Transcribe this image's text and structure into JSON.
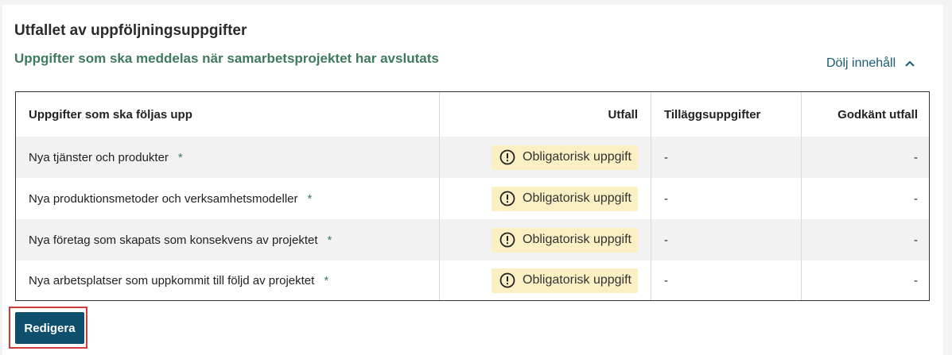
{
  "section": {
    "title": "Utfallet av uppföljningsuppgifter",
    "subtitle": "Uppgifter som ska meddelas när samarbetsprojektet har avslutats",
    "toggle_label": "Dölj innehåll",
    "toggle_icon": "chevron-up-icon"
  },
  "table": {
    "headers": [
      "Uppgifter som ska följas upp",
      "Utfall",
      "Tilläggsuppgifter",
      "Godkänt utfall"
    ],
    "rows": [
      {
        "task": "Nya tjänster och produkter",
        "required_mark": "*",
        "outcome": "Obligatorisk uppgift",
        "additional": "-",
        "approved": "-"
      },
      {
        "task": "Nya produktionsmetoder och verksamhetsmodeller",
        "required_mark": "*",
        "outcome": "Obligatorisk uppgift",
        "additional": "-",
        "approved": "-"
      },
      {
        "task": "Nya företag som skapats som konsekvens av projektet",
        "required_mark": "*",
        "outcome": "Obligatorisk uppgift",
        "additional": "-",
        "approved": "-"
      },
      {
        "task": "Nya arbetsplatser som uppkommit till följd av projektet",
        "required_mark": "*",
        "outcome": "Obligatorisk uppgift",
        "additional": "-",
        "approved": "-"
      }
    ],
    "badge_icon": "alert-circle-icon",
    "badge_color": "#fbefc4"
  },
  "actions": {
    "edit_label": "Redigera",
    "edit_color": "#0e4f6e",
    "highlight_color": "#d23a3a"
  },
  "colors": {
    "accent_green": "#3e7a5c",
    "link_blue": "#1b5a76"
  }
}
